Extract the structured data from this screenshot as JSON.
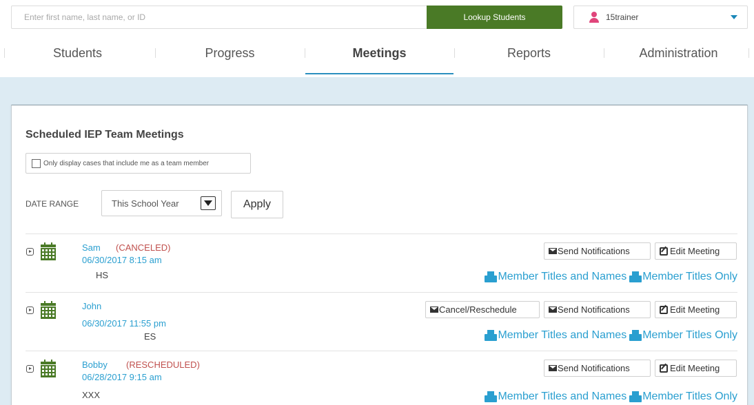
{
  "search": {
    "placeholder": "Enter first name, last name, or ID",
    "button_label": "Lookup Students"
  },
  "user": {
    "name": "15trainer",
    "icon": "user-icon"
  },
  "nav": {
    "tabs": [
      {
        "label": "Students"
      },
      {
        "label": "Progress"
      },
      {
        "label": "Meetings",
        "active": true
      },
      {
        "label": "Reports"
      },
      {
        "label": "Administration"
      }
    ]
  },
  "panel": {
    "title": "Scheduled IEP Team Meetings",
    "filter_label": "Only display cases that include me as a team member",
    "filter_checked": false,
    "date_range_label": "DATE RANGE",
    "date_range_value": "This School Year",
    "apply_label": "Apply"
  },
  "meetings": [
    {
      "name": "Sam",
      "status": "(CANCELED)",
      "datetime": "06/30/2017 8:15 am",
      "school": "HS",
      "actions": [
        "Send Notifications",
        "Edit Meeting"
      ]
    },
    {
      "name": "John",
      "status": "",
      "datetime": "06/30/2017 11:55 pm",
      "school": "ES",
      "actions": [
        "Cancel/Reschedule",
        "Send Notifications",
        "Edit Meeting"
      ]
    },
    {
      "name": "Bobby",
      "status": "(RESCHEDULED)",
      "datetime": "06/28/2017 9:15 am",
      "school": "XXX",
      "actions": [
        "Send Notifications",
        "Edit Meeting"
      ]
    }
  ],
  "print_links": {
    "names": "Member Titles and Names",
    "titles": "Member Titles Only"
  },
  "colors": {
    "accent": "#2a9fd0",
    "lookup_green": "#4a7a26",
    "calendar_green": "#4a7a26",
    "status_red": "#c0504d",
    "band": "#ddebf3"
  }
}
